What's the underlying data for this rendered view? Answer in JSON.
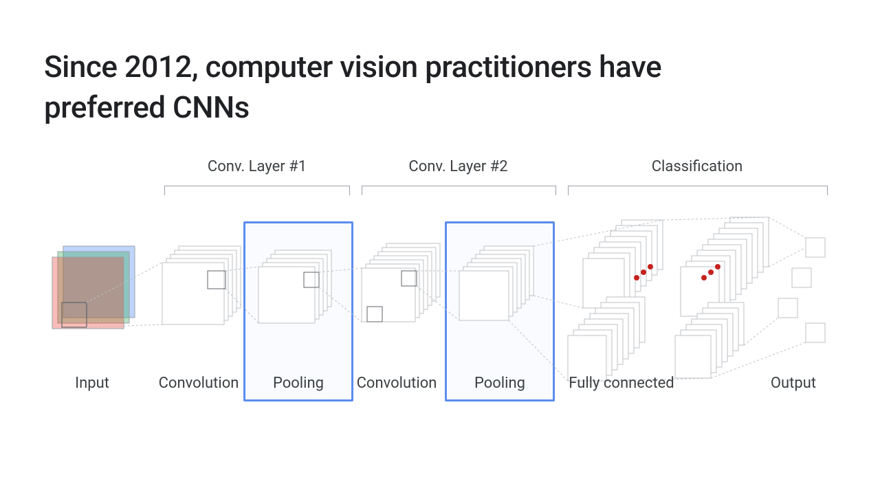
{
  "title": "Since 2012, computer vision practitioners have preferred CNNs",
  "sections": {
    "conv1": "Conv. Layer #1",
    "conv2": "Conv. Layer #2",
    "classification": "Classification"
  },
  "stages": {
    "input": "Input",
    "convolution1": "Convolution",
    "pooling1": "Pooling",
    "convolution2": "Convolution",
    "pooling2": "Pooling",
    "fullyconnected": "Fully connected",
    "output": "Output"
  },
  "colors": {
    "highlight": "#5b8def",
    "red_dot": "#c5221f",
    "input_r": "rgba(234,67,53,0.35)",
    "input_g": "rgba(52,168,83,0.35)",
    "input_b": "rgba(66,133,244,0.35)",
    "line": "#bdc1c6"
  }
}
